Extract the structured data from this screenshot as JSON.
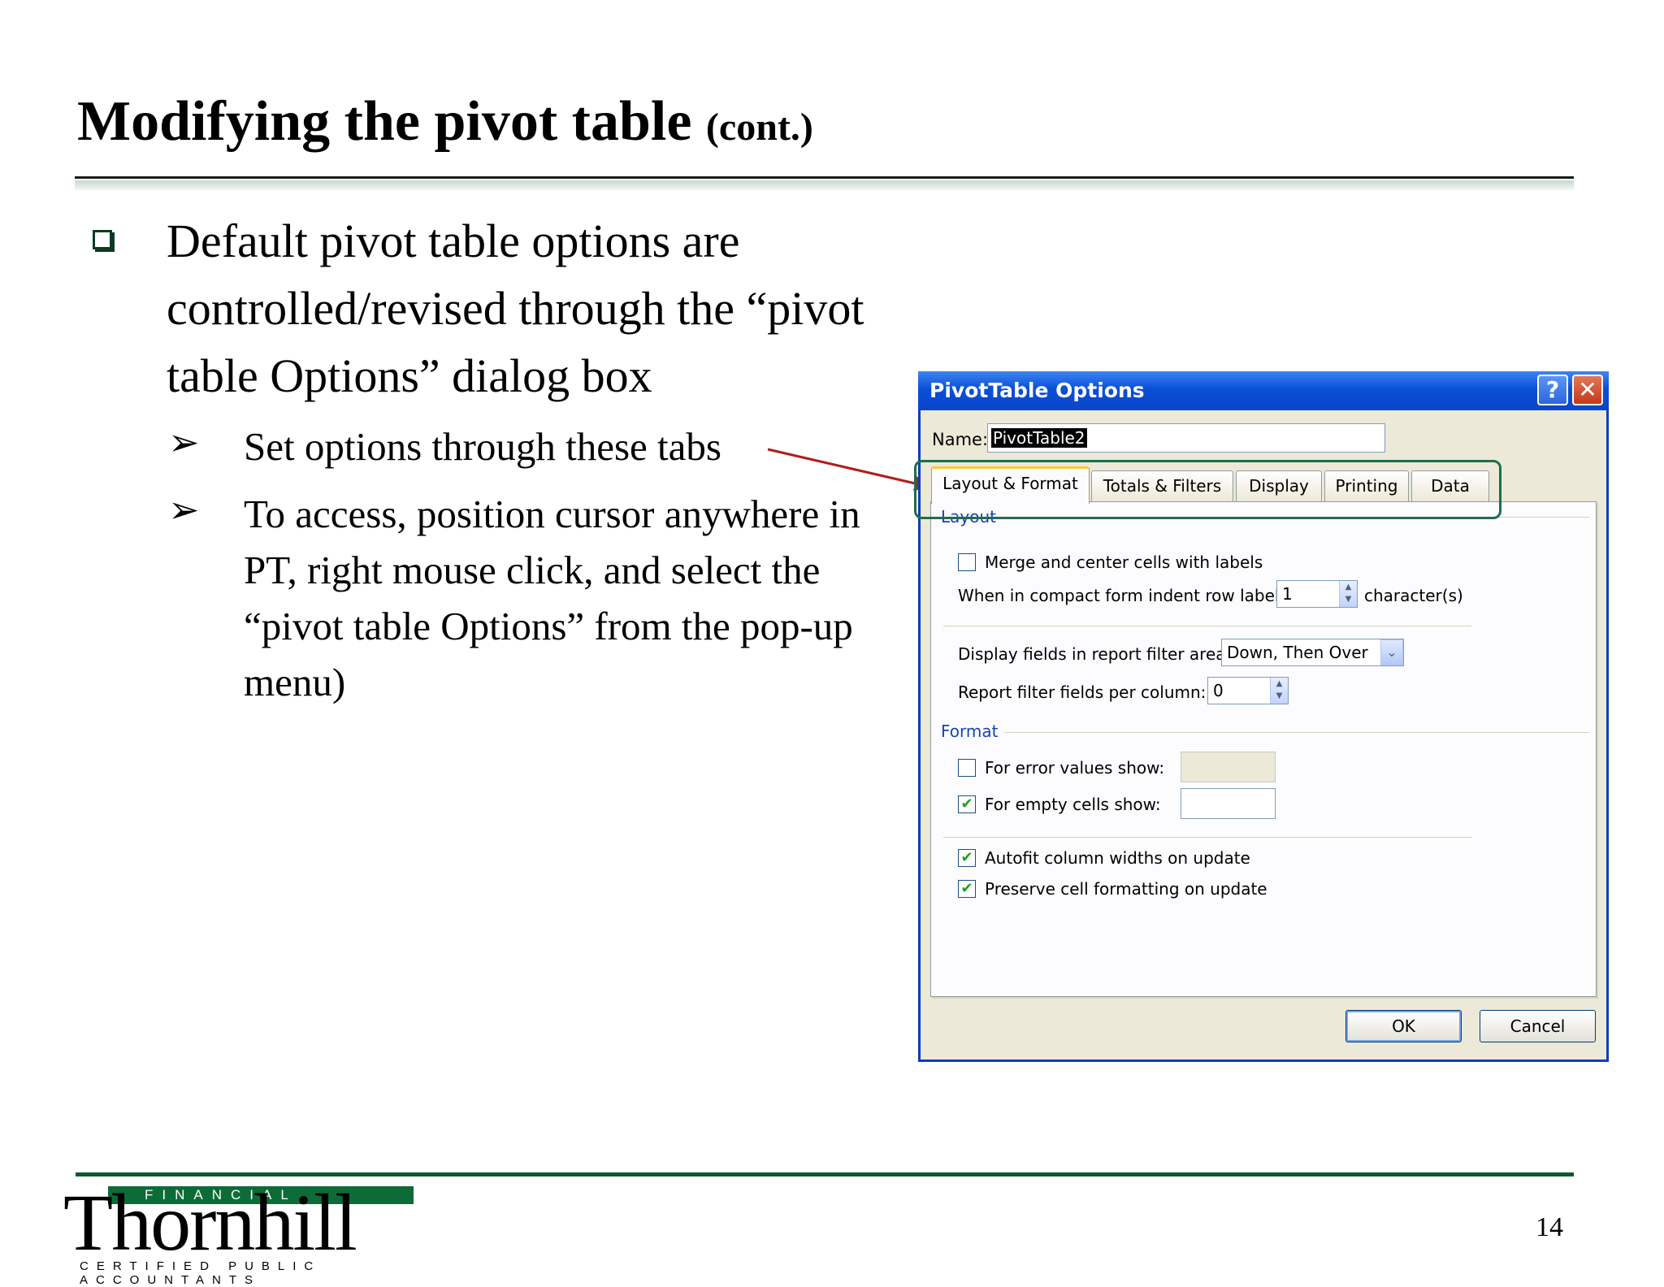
{
  "slide": {
    "title": "Modifying the pivot table",
    "title_sub": "(cont.)",
    "bullet_main": "Default pivot table options are controlled/revised through the “pivot table Options” dialog box",
    "sub_bullets": [
      "Set options through these tabs",
      "To access, position cursor anywhere in PT, right mouse click, and select the “pivot table Options” from the pop-up menu)"
    ],
    "page_number": "14"
  },
  "logo": {
    "word": "Thornhill",
    "financial": "FINANCIAL",
    "tagline": "CERTIFIED PUBLIC ACCOUNTANTS"
  },
  "dialog": {
    "title": "PivotTable Options",
    "help_glyph": "?",
    "close_glyph": "✕",
    "name_label": "Name:",
    "name_value": "PivotTable2",
    "tabs": [
      "Layout & Format",
      "Totals & Filters",
      "Display",
      "Printing",
      "Data"
    ],
    "active_tab": "Layout & Format",
    "layout_group": "Layout",
    "merge_label": "Merge and center cells with labels",
    "merge_checked": false,
    "indent_label": "When in compact form indent row labels:",
    "indent_value": "1",
    "indent_suffix": "character(s)",
    "display_fields_label": "Display fields in report filter area:",
    "display_fields_value": "Down, Then Over",
    "filter_fields_label": "Report filter fields per column:",
    "filter_fields_value": "0",
    "format_group": "Format",
    "error_values_label": "For error values show:",
    "error_values_checked": false,
    "error_values_value": "",
    "empty_cells_label": "For empty cells show:",
    "empty_cells_checked": true,
    "empty_cells_value": "",
    "autofit_label": "Autofit column widths on update",
    "autofit_checked": true,
    "preserve_label": "Preserve cell formatting on update",
    "preserve_checked": true,
    "ok_label": "OK",
    "cancel_label": "Cancel",
    "check_glyph": "✔",
    "spin_up": "▲",
    "spin_down": "▼",
    "dropdown_glyph": "⌄"
  },
  "colors": {
    "titlebar": "#0a4fd6",
    "highlight_box": "#1d6e4c",
    "arrow": "#b01c1c",
    "accent_green": "#0d5a2e"
  }
}
